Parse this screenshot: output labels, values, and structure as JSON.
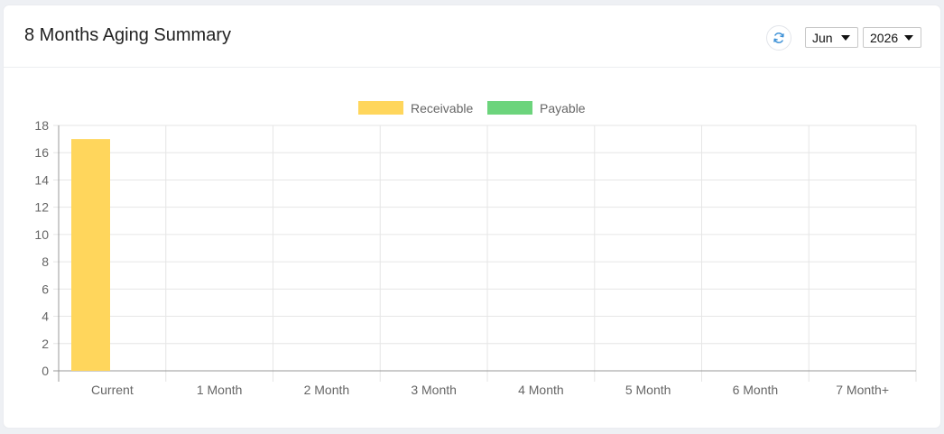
{
  "header": {
    "title": "8 Months Aging Summary",
    "month_selected": "Jun",
    "year_selected": "2026",
    "refresh_icon": "refresh-icon"
  },
  "colors": {
    "receivable": "#ffd65c",
    "payable": "#6cd47c",
    "grid": "#e6e6e6",
    "axis": "#999999",
    "tick_text": "#666666",
    "accent": "#3a8fd6"
  },
  "chart_data": {
    "type": "bar",
    "categories": [
      "Current",
      "1 Month",
      "2 Month",
      "3 Month",
      "4 Month",
      "5 Month",
      "6 Month",
      "7 Month+"
    ],
    "series": [
      {
        "name": "Receivable",
        "values": [
          17,
          0,
          0,
          0,
          0,
          0,
          0,
          0
        ]
      },
      {
        "name": "Payable",
        "values": [
          0,
          0,
          0,
          0,
          0,
          0,
          0,
          0
        ]
      }
    ],
    "ylim": [
      0,
      18
    ],
    "yticks": [
      0,
      2,
      4,
      6,
      8,
      10,
      12,
      14,
      16,
      18
    ],
    "legend": "top-center",
    "grid": true
  }
}
